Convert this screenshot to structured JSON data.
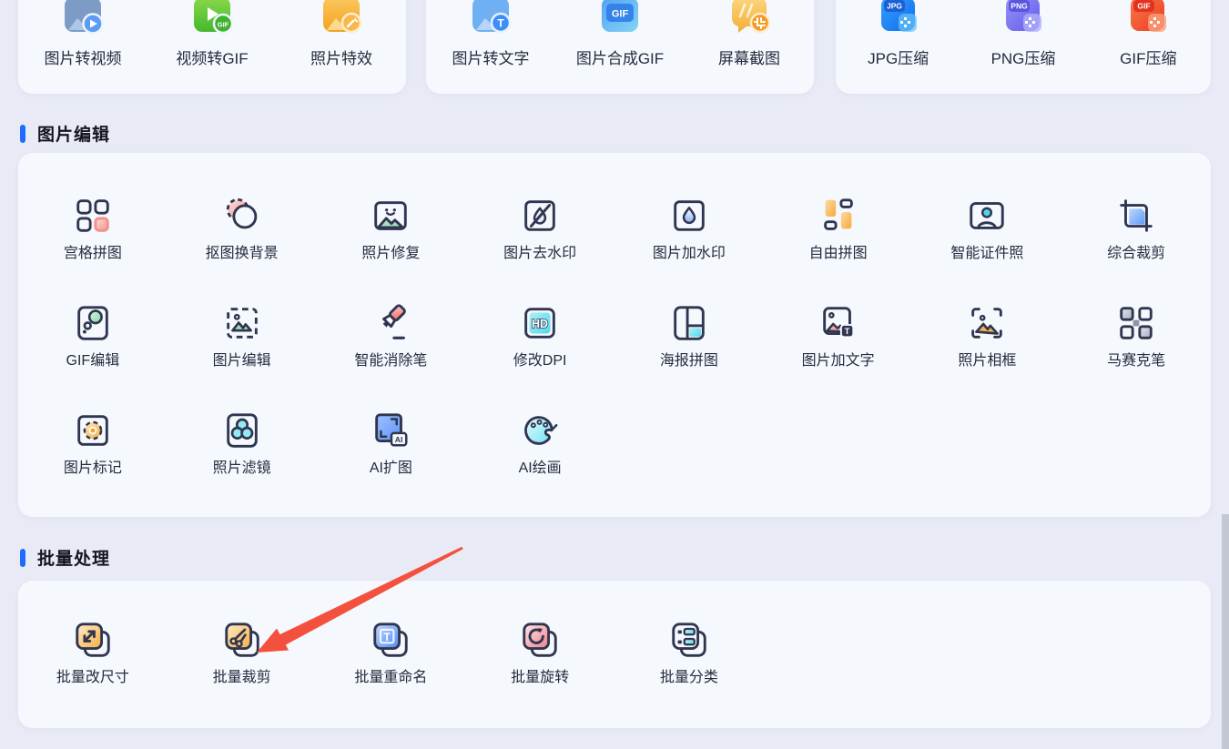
{
  "page": {
    "background_color": "#e8ebf5",
    "card_color": "#f5f8fd",
    "accent_color": "#1f6bff",
    "arrow_color": "#f4503e"
  },
  "top_cards": [
    {
      "items": [
        {
          "label": "图片转视频",
          "icon": "image-to-video-icon"
        },
        {
          "label": "视频转GIF",
          "icon": "video-to-gif-icon"
        },
        {
          "label": "照片特效",
          "icon": "photo-effects-icon"
        }
      ]
    },
    {
      "items": [
        {
          "label": "图片转文字",
          "icon": "image-to-text-icon"
        },
        {
          "label": "图片合成GIF",
          "icon": "image-to-gif-icon"
        },
        {
          "label": "屏幕截图",
          "icon": "screenshot-icon"
        }
      ]
    },
    {
      "items": [
        {
          "label": "JPG压缩",
          "icon": "jpg-compress-icon"
        },
        {
          "label": "PNG压缩",
          "icon": "png-compress-icon"
        },
        {
          "label": "GIF压缩",
          "icon": "gif-compress-icon"
        }
      ]
    }
  ],
  "sections": [
    {
      "title": "图片编辑",
      "tools": [
        {
          "label": "宫格拼图",
          "icon": "grid-collage-icon"
        },
        {
          "label": "抠图换背景",
          "icon": "cutout-background-icon"
        },
        {
          "label": "照片修复",
          "icon": "photo-repair-icon"
        },
        {
          "label": "图片去水印",
          "icon": "remove-watermark-icon"
        },
        {
          "label": "图片加水印",
          "icon": "add-watermark-icon"
        },
        {
          "label": "自由拼图",
          "icon": "free-collage-icon"
        },
        {
          "label": "智能证件照",
          "icon": "id-photo-icon"
        },
        {
          "label": "综合裁剪",
          "icon": "crop-icon"
        },
        {
          "label": "GIF编辑",
          "icon": "gif-edit-icon"
        },
        {
          "label": "图片编辑",
          "icon": "image-edit-icon"
        },
        {
          "label": "智能消除笔",
          "icon": "smart-eraser-icon"
        },
        {
          "label": "修改DPI",
          "icon": "dpi-icon"
        },
        {
          "label": "海报拼图",
          "icon": "poster-collage-icon"
        },
        {
          "label": "图片加文字",
          "icon": "image-add-text-icon"
        },
        {
          "label": "照片相框",
          "icon": "photo-frame-icon"
        },
        {
          "label": "马赛克笔",
          "icon": "mosaic-pen-icon"
        },
        {
          "label": "图片标记",
          "icon": "image-mark-icon"
        },
        {
          "label": "照片滤镜",
          "icon": "photo-filter-icon"
        },
        {
          "label": "AI扩图",
          "icon": "ai-expand-icon"
        },
        {
          "label": "AI绘画",
          "icon": "ai-paint-icon"
        }
      ]
    },
    {
      "title": "批量处理",
      "tools": [
        {
          "label": "批量改尺寸",
          "icon": "batch-resize-icon"
        },
        {
          "label": "批量裁剪",
          "icon": "batch-crop-icon"
        },
        {
          "label": "批量重命名",
          "icon": "batch-rename-icon"
        },
        {
          "label": "批量旋转",
          "icon": "batch-rotate-icon"
        },
        {
          "label": "批量分类",
          "icon": "batch-classify-icon"
        }
      ]
    }
  ],
  "annotation": {
    "type": "red-arrow",
    "points_to": "批量裁剪"
  }
}
